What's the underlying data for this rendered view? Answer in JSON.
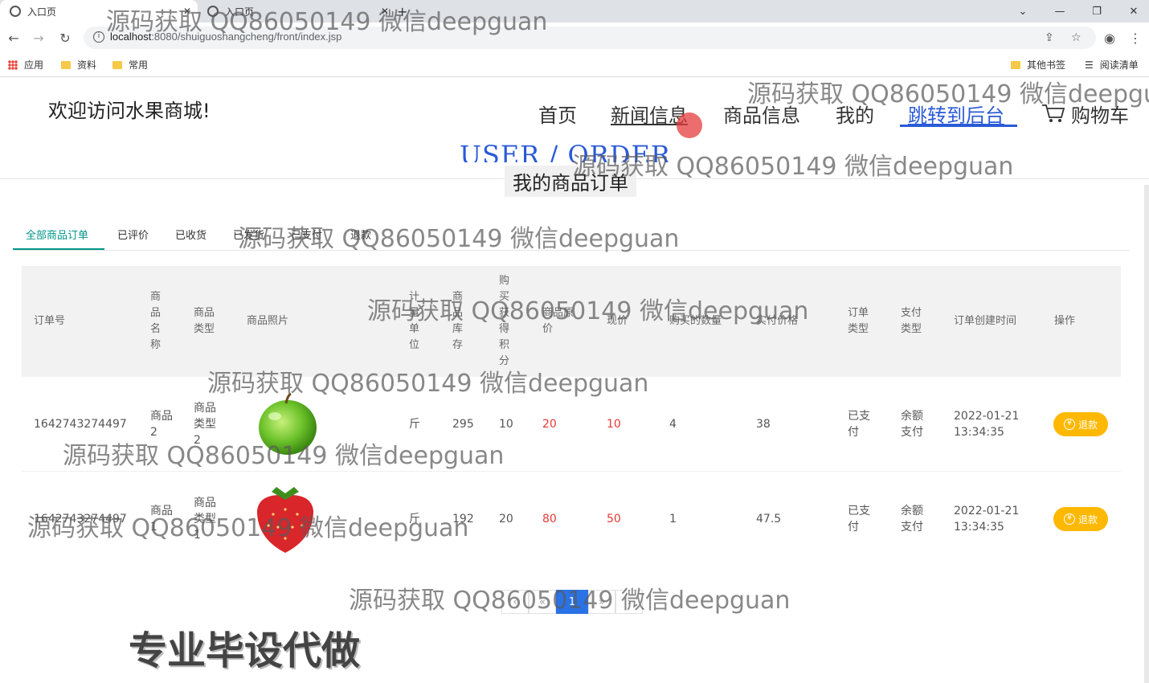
{
  "browser": {
    "tabs": [
      {
        "title": "入口页"
      },
      {
        "title": "入口页"
      }
    ],
    "url_host": "localhost",
    "url_path": ":8080/shuiguoshangcheng/front/index.jsp",
    "bookmarks": [
      "应用",
      "资料",
      "常用",
      "其他书签",
      "阅读清单"
    ]
  },
  "header": {
    "site_title": "欢迎访问水果商城!",
    "nav": {
      "home": "首页",
      "news": "新闻信息",
      "products": "商品信息",
      "mine": "我的",
      "admin": "跳转到后台",
      "cart": "购物车"
    }
  },
  "section": {
    "title_en": "USER / ORDER",
    "title_cn": "我的商品订单"
  },
  "order_tabs": [
    "全部商品订单",
    "已评价",
    "已收货",
    "已发货",
    "已支付",
    "退款"
  ],
  "table": {
    "headers": {
      "order_no": "订单号",
      "name": "商品名称",
      "type": "商品类型",
      "photo": "商品照片",
      "unit": "计量单位",
      "stock": "商品库存",
      "points": "购买获得积分",
      "orig_price": "商品原价",
      "cur_price": "现价",
      "qty": "购买的数量",
      "paid": "实付价格",
      "order_type": "订单类型",
      "pay_type": "支付类型",
      "created": "订单创建时间",
      "action": "操作"
    },
    "rows": [
      {
        "order_no": "1642743274497",
        "name": "商品2",
        "type": "商品类型2",
        "photo": "green-apple",
        "unit": "斤",
        "stock": "295",
        "points": "10",
        "orig_price": "20",
        "cur_price": "10",
        "qty": "4",
        "paid": "38",
        "order_type": "已支付",
        "pay_type": "余额支付",
        "created_date": "2022-01-21",
        "created_time": "13:34:35",
        "action": "退款"
      },
      {
        "order_no": "1642743274497",
        "name": "商品1",
        "type": "商品类型1",
        "photo": "strawberry",
        "unit": "斤",
        "stock": "192",
        "points": "20",
        "orig_price": "80",
        "cur_price": "50",
        "qty": "1",
        "paid": "47.5",
        "order_type": "已支付",
        "pay_type": "余额支付",
        "created_date": "2022-01-21",
        "created_time": "13:34:35",
        "action": "退款"
      }
    ]
  },
  "pagination": {
    "current": "1"
  },
  "watermark": "源码获取 QQ86050149 微信deepguan",
  "promo": "专业毕设代做",
  "colors": {
    "accent": "#009688",
    "link": "#2a5bd7",
    "price": "#e53935",
    "refund": "#ffb800",
    "page_current": "#2a72e5"
  }
}
